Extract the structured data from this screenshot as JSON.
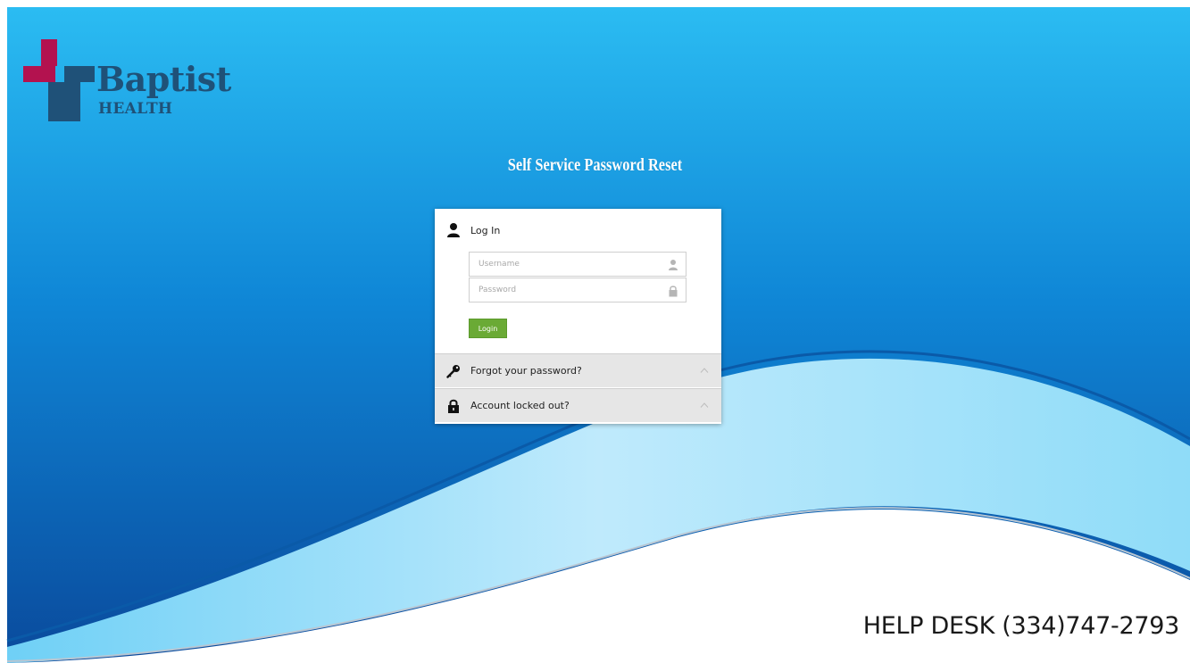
{
  "brand": {
    "name": "Baptist",
    "sub": "HEALTH"
  },
  "page": {
    "title": "Self Service Password Reset"
  },
  "login": {
    "heading": "Log In",
    "username_placeholder": "Username",
    "password_placeholder": "Password",
    "button": "Login"
  },
  "sections": [
    {
      "label": "Forgot your password?",
      "icon": "key-icon"
    },
    {
      "label": "Account locked out?",
      "icon": "lock-icon"
    }
  ],
  "footer": {
    "helpdesk": "HELP DESK (334)747-2793"
  },
  "colors": {
    "logo_red": "#b3124f",
    "logo_blue": "#1f5178",
    "login_green": "#6aaa35",
    "sky_blue": "#1aa5e6"
  }
}
